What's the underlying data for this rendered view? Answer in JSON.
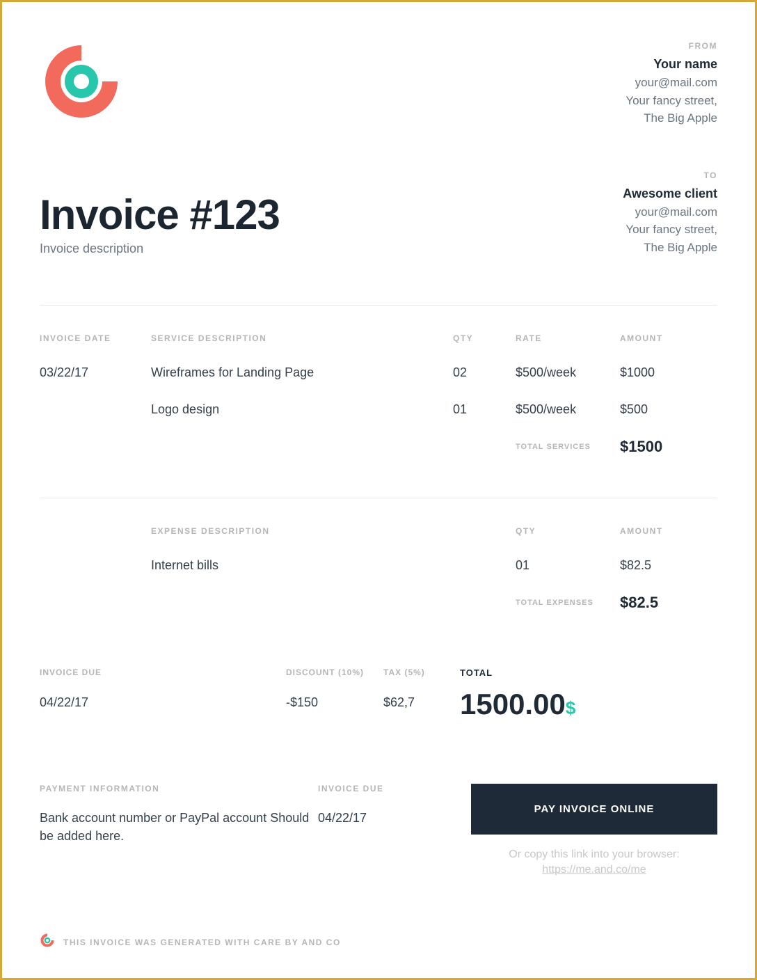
{
  "from": {
    "label": "FROM",
    "name": "Your name",
    "email": "your@mail.com",
    "street": "Your fancy street,",
    "city": "The Big Apple"
  },
  "to": {
    "label": "TO",
    "name": "Awesome client",
    "email": "your@mail.com",
    "street": "Your fancy street,",
    "city": "The Big Apple"
  },
  "invoice": {
    "title": "Invoice #123",
    "description": "Invoice description",
    "date_label": "INVOICE DATE",
    "date": "03/22/17",
    "due_label": "INVOICE DUE",
    "due": "04/22/17"
  },
  "services": {
    "head_desc": "SERVICE DESCRIPTION",
    "head_qty": "QTY",
    "head_rate": "RATE",
    "head_amount": "AMOUNT",
    "items": [
      {
        "desc": "Wireframes for Landing Page",
        "qty": "02",
        "rate": "$500/week",
        "amount": "$1000"
      },
      {
        "desc": "Logo design",
        "qty": "01",
        "rate": "$500/week",
        "amount": "$500"
      }
    ],
    "total_label": "TOTAL SERVICES",
    "total": "$1500"
  },
  "expenses": {
    "head_desc": "EXPENSE DESCRIPTION",
    "head_qty": "QTY",
    "head_amount": "AMOUNT",
    "items": [
      {
        "desc": "Internet bills",
        "qty": "01",
        "amount": "$82.5"
      }
    ],
    "total_label": "TOTAL EXPENSES",
    "total": "$82.5"
  },
  "totals": {
    "discount_label": "DISCOUNT (10%)",
    "discount": "-$150",
    "tax_label": "TAX (5%)",
    "tax": "$62,7",
    "total_label": "TOTAL",
    "total": "1500.00",
    "currency": "$"
  },
  "payment": {
    "info_label": "PAYMENT INFORMATION",
    "info_body": "Bank account number or PayPal account Should be added here.",
    "due_label": "INVOICE DUE",
    "due": "04/22/17",
    "button": "PAY INVOICE ONLINE",
    "copy_text": "Or copy this link into your browser: ",
    "copy_link": "https://me.and.co/me"
  },
  "footer": {
    "text": "THIS INVOICE WAS GENERATED WITH CARE BY AND CO"
  },
  "colors": {
    "accent_coral": "#f16a5b",
    "accent_teal": "#28c7ab",
    "dark": "#1e2a37"
  }
}
